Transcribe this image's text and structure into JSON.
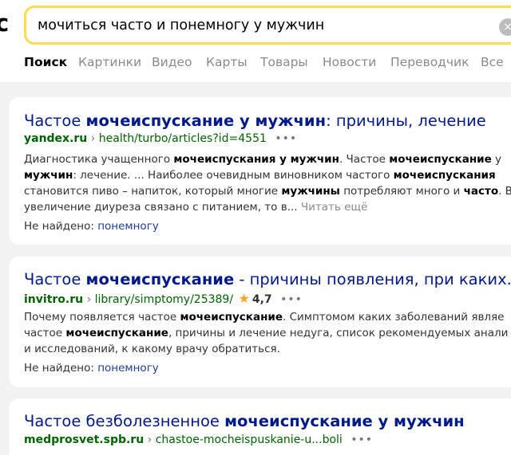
{
  "header": {
    "logo_fragment": "c",
    "search_query": "мочиться часто и понемногу у мужчин",
    "clear_icon": "×",
    "tabs": [
      "Поиск",
      "Картинки",
      "Видео",
      "Карты",
      "Товары",
      "Новости",
      "Переводчик",
      "Все"
    ]
  },
  "results": [
    {
      "title_parts": [
        "Частое ",
        "мочеиспускание у мужчин",
        ": причины, лечение"
      ],
      "domain": "yandex.ru",
      "separator": "›",
      "path": "health/turbo/articles?id=4551",
      "dots": "•••",
      "snippet_lines": [
        [
          "Диагностика учащенного ",
          "мочеиспускания у мужчин",
          ". Частое ",
          "мочеиспускание",
          " у"
        ],
        [
          "",
          "мужчин",
          ": лечение. ... Наиболее очевидным виновником частого ",
          "мочеиспускания",
          ""
        ],
        [
          "становится пиво – напиток, который многие ",
          "мужчины",
          " потребляют много и ",
          "часто",
          ". В"
        ],
        [
          "увеличение диуреза связано с питанием, то в...",
          "",
          "",
          "",
          ""
        ]
      ],
      "read_more": "Читать ещё",
      "not_found_label": "Не найдено:",
      "not_found_word": "понемногу"
    },
    {
      "title_parts": [
        "Частое ",
        "мочеиспускание",
        " - причины появления, при каких..."
      ],
      "domain": "invitro.ru",
      "separator": "›",
      "path": "library/simptomy/25389/",
      "star_icon": "★",
      "rating": "4,7",
      "dots": "•••",
      "snippet_lines": [
        [
          "Почему появляется частое ",
          "мочеиспускание",
          ". Симптомом каких заболеваний являе"
        ],
        [
          "частое ",
          "мочеиспускание",
          ", причины и лечение недуга, список рекомендуемых анали"
        ],
        [
          "и исследований, к какому врачу обратиться.",
          "",
          ""
        ]
      ],
      "not_found_label": "Не найдено:",
      "not_found_word": "понемногу"
    },
    {
      "title_parts": [
        "Частое безболезненное ",
        "мочеиспускание у мужчин",
        ""
      ],
      "domain": "medprosvet.spb.ru",
      "separator": "›",
      "path": "chastoe-mocheispuskanie-u...boli",
      "dots": "•••"
    }
  ],
  "colors": {
    "search_border": "#ffdb4d",
    "title_link": "#001a8a",
    "url_green": "#006400",
    "page_bg": "#f2f2f2"
  }
}
